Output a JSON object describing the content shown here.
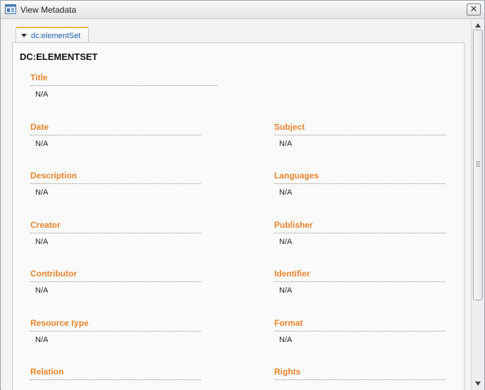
{
  "window": {
    "title": "View Metadata",
    "close_glyph": "✕",
    "close_label": "X"
  },
  "tab": {
    "label": "dc:elementSet"
  },
  "section": {
    "heading": "DC:ELEMENTSET"
  },
  "fields": {
    "title": {
      "label": "Title",
      "value": "N/A"
    },
    "date": {
      "label": "Date",
      "value": "N/A"
    },
    "subject": {
      "label": "Subject",
      "value": "N/A"
    },
    "description": {
      "label": "Description",
      "value": "N/A"
    },
    "languages": {
      "label": "Languages",
      "value": "N/A"
    },
    "creator": {
      "label": "Creator",
      "value": "N/A"
    },
    "publisher": {
      "label": "Publisher",
      "value": "N/A"
    },
    "contributor": {
      "label": "Contributor",
      "value": "N/A"
    },
    "identifier": {
      "label": "Identifier",
      "value": "N/A"
    },
    "resource_type": {
      "label": "Resource type",
      "value": "N/A"
    },
    "format": {
      "label": "Format",
      "value": "N/A"
    },
    "relation": {
      "label": "Relation",
      "value": ""
    },
    "rights": {
      "label": "Rights",
      "value": ""
    }
  },
  "colors": {
    "label_accent": "#e8842b",
    "tab_text": "#1a5fa8",
    "tab_border_top": "#e8b84b"
  },
  "icons": {
    "window": "window-icon",
    "close": "close-icon",
    "tab_toggle": "triangle-down-icon",
    "scroll_up": "scroll-up-arrow-icon",
    "scroll_down": "scroll-down-arrow-icon"
  }
}
